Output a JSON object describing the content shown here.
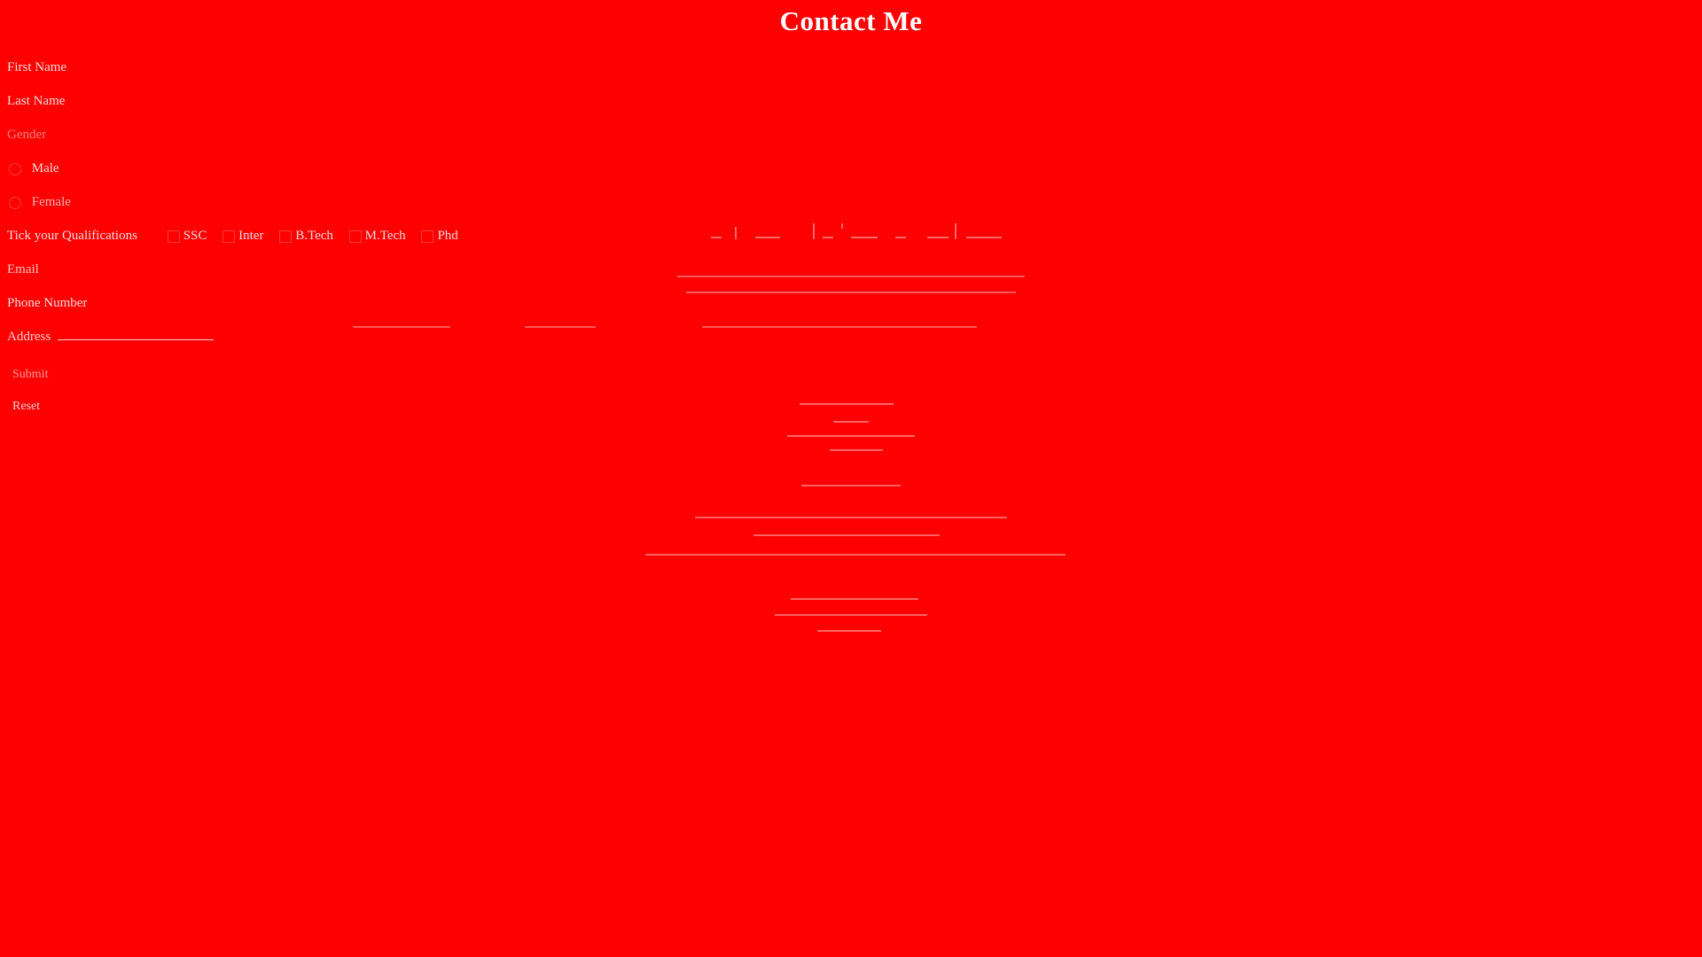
{
  "page": {
    "title": "Contact Me"
  },
  "form": {
    "first_name_label": "First Name",
    "last_name_label": "Last Name",
    "gender_label": "Gender",
    "gender_options": [
      "Male",
      "Female"
    ],
    "qualifications_label": "Tick your Qualifications",
    "qualifications": [
      "SSC",
      "Inter",
      "B.Tech",
      "M.Tech",
      "Phd"
    ],
    "email_label": "Email",
    "phone_label": "Phone Number",
    "address_label": "Address",
    "submit_label": "Submit",
    "reset_label": "Reset"
  },
  "colors": {
    "background": "#ff0000",
    "text": "#ffffff"
  }
}
